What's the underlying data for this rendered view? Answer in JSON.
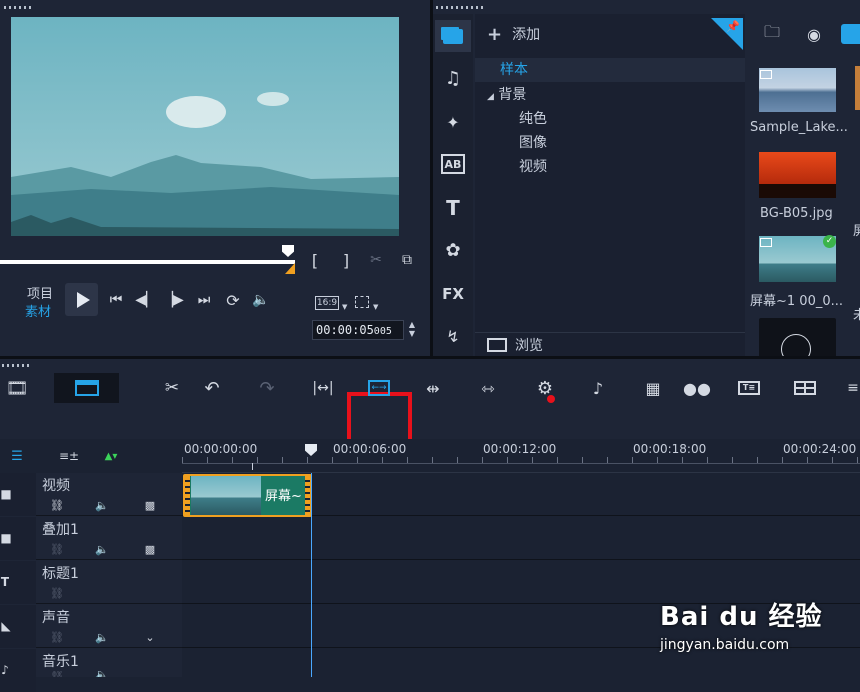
{
  "player": {
    "project_label": "项目",
    "clip_label": "素材",
    "aspect": "16:9",
    "timecode": "00:00:05",
    "frames": "005"
  },
  "library": {
    "add_label": "添加",
    "tree": {
      "sample": "样本",
      "background": "背景",
      "solid": "纯色",
      "image": "图像",
      "video": "视频"
    },
    "browse_label": "浏览",
    "fx_label": "FX",
    "ab_label": "AB",
    "thumbnails": [
      {
        "name": "Sample_Lake..."
      },
      {
        "name": "BG-B05.jpg"
      },
      {
        "name": "屏幕~1 00_0..."
      },
      {
        "name": ""
      }
    ],
    "side_cuts": [
      "屏",
      "未"
    ]
  },
  "timeline": {
    "ruler": [
      "00:00:00:00",
      "00:00:06:00",
      "00:00:12:00",
      "00:00:18:00",
      "00:00:24:00"
    ],
    "tracks": [
      {
        "name": "视频"
      },
      {
        "name": "叠加1"
      },
      {
        "name": "标题1"
      },
      {
        "name": "声音"
      },
      {
        "name": "音乐1"
      }
    ],
    "clip_label": "屏幕~"
  },
  "watermark": {
    "brand": "Bai du 经验",
    "url": "jingyan.baidu.com"
  },
  "colors": {
    "accent": "#26a4e8",
    "highlight": "#e8111b",
    "clip_border": "#f0a020",
    "clip_bg": "#1b7a64"
  }
}
